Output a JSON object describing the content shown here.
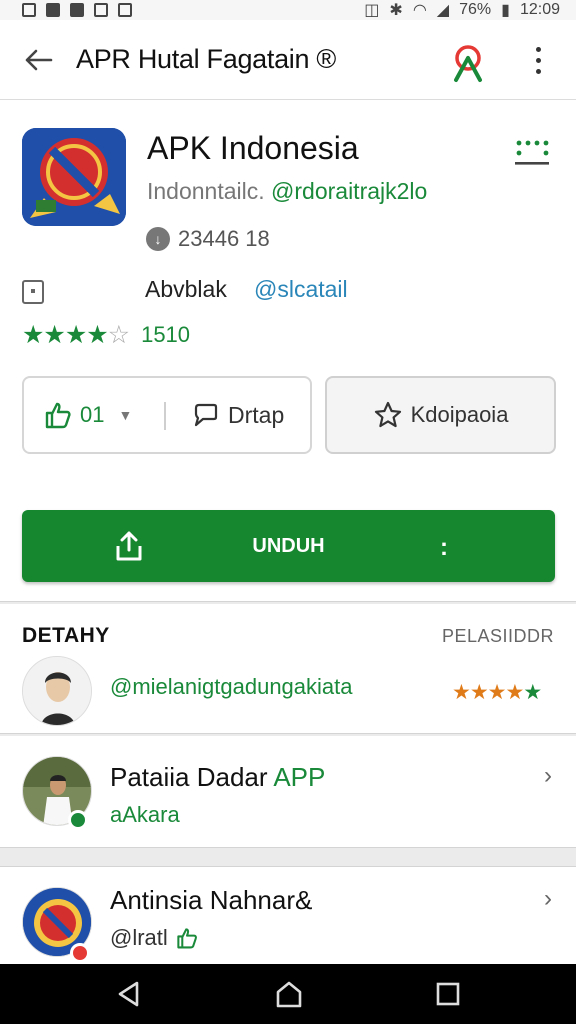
{
  "status_bar": {
    "battery": "76%",
    "time": "12:09"
  },
  "app_bar": {
    "title": "APR Hutal Fagatain ®"
  },
  "app": {
    "name": "APK Indonesia",
    "subtitle_text": "Indonntailc.",
    "subtitle_link": "@rdoraitrajk2lo",
    "download_count": "23446 18",
    "developer_name": "Abvblak",
    "developer_handle": "@slcatail",
    "stars": "★★★★",
    "stars_empty": "☆",
    "rating_count": "1510"
  },
  "actions": {
    "like_count": "01",
    "chat_label": "Drtap",
    "favorite_label": "Kdoipaoia"
  },
  "install": {
    "label": "UNDUH",
    "more": ":"
  },
  "details": {
    "title": "DETAHY",
    "link": "PELASIIDDR",
    "review_user": "@mielanigtgadungakiata",
    "review_stars": "★★★★",
    "review_stars_extra": "★"
  },
  "items": [
    {
      "title": "Pataiia Dadar",
      "title_accent": "APP",
      "subtitle": "aAkara",
      "status_color": "#1a8a3a"
    },
    {
      "title": "Antinsia Nahnar&",
      "subtitle": "@lratl",
      "status_color": "#e53935"
    }
  ],
  "colors": {
    "accent": "#1a8a3a",
    "install": "#16862f",
    "link_blue": "#2a86b8",
    "star_orange": "#e07b1a"
  }
}
